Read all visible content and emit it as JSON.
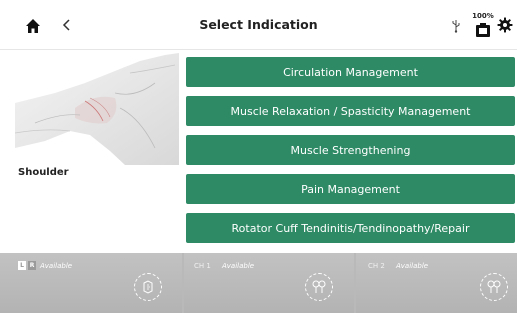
{
  "header": {
    "title": "Select Indication",
    "battery_percent": "100%"
  },
  "body_part": {
    "label": "Shoulder"
  },
  "indications": [
    {
      "label": "Circulation Management"
    },
    {
      "label": "Muscle Relaxation / Spasticity Management"
    },
    {
      "label": "Muscle Strengthening"
    },
    {
      "label": "Pain Management"
    },
    {
      "label": "Rotator Cuff Tendinitis/Tendinopathy/Repair"
    }
  ],
  "footer": {
    "panel1": {
      "left_box": "L",
      "right_box": "R",
      "status": "Available"
    },
    "panel2": {
      "channel": "CH 1",
      "status": "Available"
    },
    "panel3": {
      "channel": "CH 2",
      "status": "Available"
    }
  },
  "colors": {
    "button_green": "#2d8a65",
    "footer_gray": "#b9b9b9"
  },
  "icons": [
    "home-icon",
    "back-icon",
    "usb-icon",
    "battery-icon",
    "gear-icon",
    "ultrasound-head-icon",
    "electrode-icon"
  ]
}
